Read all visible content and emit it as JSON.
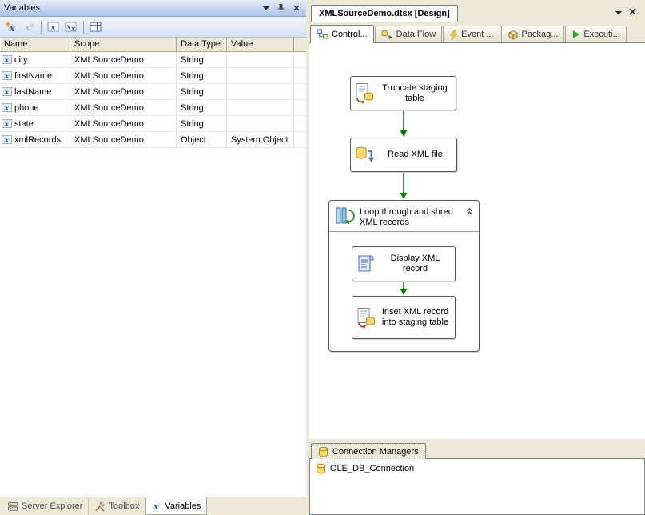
{
  "colors": {
    "panel_background": "#ece9d8",
    "titlebar_gradient_top": "#e6eefb",
    "titlebar_gradient_bottom": "#a9c0e8",
    "arrow_green": "#007a00",
    "variable_icon_blue": "#2a52c8",
    "cylinder_yellow": "#ffd96e",
    "task_border": "#565656"
  },
  "variables_panel": {
    "title": "Variables",
    "columns": [
      "Name",
      "Scope",
      "Data Type",
      "Value"
    ],
    "rows": [
      {
        "name": "city",
        "scope": "XMLSourceDemo",
        "data_type": "String",
        "value": ""
      },
      {
        "name": "firstName",
        "scope": "XMLSourceDemo",
        "data_type": "String",
        "value": ""
      },
      {
        "name": "lastName",
        "scope": "XMLSourceDemo",
        "data_type": "String",
        "value": ""
      },
      {
        "name": "phone",
        "scope": "XMLSourceDemo",
        "data_type": "String",
        "value": ""
      },
      {
        "name": "state",
        "scope": "XMLSourceDemo",
        "data_type": "String",
        "value": ""
      },
      {
        "name": "xmlRecords",
        "scope": "XMLSourceDemo",
        "data_type": "Object",
        "value": "System.Object"
      }
    ]
  },
  "bottom_tabs": [
    {
      "label": "Server Explorer",
      "selected": false
    },
    {
      "label": "Toolbox",
      "selected": false
    },
    {
      "label": "Variables",
      "selected": true
    }
  ],
  "designer": {
    "document_tab": "XMLSourceDemo.dtsx [Design]",
    "tabs": [
      {
        "label": "Control...",
        "selected": true
      },
      {
        "label": "Data Flow",
        "selected": false
      },
      {
        "label": "Event ...",
        "selected": false
      },
      {
        "label": "Packag...",
        "selected": false
      },
      {
        "label": "Executi...",
        "selected": false
      }
    ],
    "tasks": {
      "truncate": {
        "label": "Truncate staging table"
      },
      "read_xml": {
        "label": "Read XML file"
      },
      "loop": {
        "label": "Loop through and shred XML records"
      },
      "display": {
        "label": "Display XML record"
      },
      "insert": {
        "label": "Inset XML record into staging table"
      }
    }
  },
  "connection_managers": {
    "tab_label": "Connection Managers",
    "items": [
      {
        "label": "OLE_DB_Connection"
      }
    ]
  }
}
